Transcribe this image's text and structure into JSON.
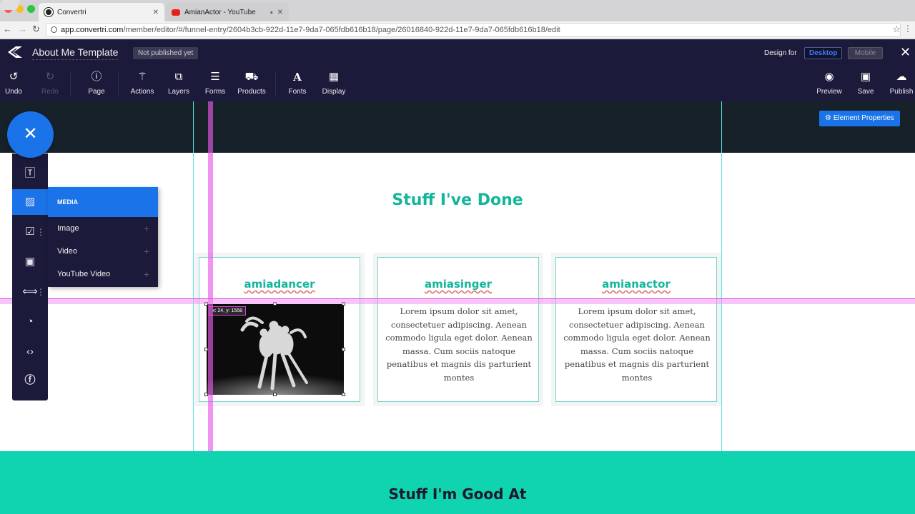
{
  "browser": {
    "tabs": [
      {
        "title": "Convertri",
        "active": true
      },
      {
        "title": "AmianActor - YouTube",
        "active": false
      }
    ],
    "url_host": "app.convertri.com",
    "url_path": "/member/editor/#/funnel-entry/2604b3cb-922d-11e7-9da7-065fdb616b18/page/26016840-922d-11e7-9da7-065fdb616b18/edit"
  },
  "header": {
    "title": "About Me Template",
    "status": "Not published yet",
    "design_for_label": "Design for",
    "device_desktop": "Desktop",
    "device_mobile": "Mobile"
  },
  "toolbar": {
    "undo": "Undo",
    "redo": "Redo",
    "page": "Page",
    "actions": "Actions",
    "layers": "Layers",
    "forms": "Forms",
    "products": "Products",
    "fonts": "Fonts",
    "display": "Display",
    "preview": "Preview",
    "save": "Save",
    "publish": "Publish"
  },
  "canvas": {
    "element_properties": "Element Properties",
    "section_title": "Stuff I've Done",
    "coord_readout": "x: 24, y: 1558",
    "cards": [
      {
        "title": "amiadancer",
        "body": ""
      },
      {
        "title": "amiasinger",
        "body": "Lorem ipsum dolor sit amet, consectetuer adipiscing. Aenean commodo ligula eget dolor. Aenean massa. Cum sociis natoque penatibus et magnis dis parturient montes"
      },
      {
        "title": "amianactor",
        "body": "Lorem ipsum dolor sit amet, consectetuer adipiscing. Aenean commodo ligula eget dolor. Aenean massa. Cum sociis natoque penatibus et magnis dis parturient montes"
      }
    ],
    "next_section_title": "Stuff I'm Good At"
  },
  "media_panel": {
    "header": "MEDIA",
    "items": [
      "Image",
      "Video",
      "YouTube Video"
    ]
  },
  "colors": {
    "header_bg": "#1c1a3a",
    "accent_blue": "#1a73e8",
    "teal_heading": "#13b59b",
    "teal_section": "#10d3b0",
    "guide_pink": "#e040e0",
    "guide_cyan": "#5fe3e3"
  }
}
